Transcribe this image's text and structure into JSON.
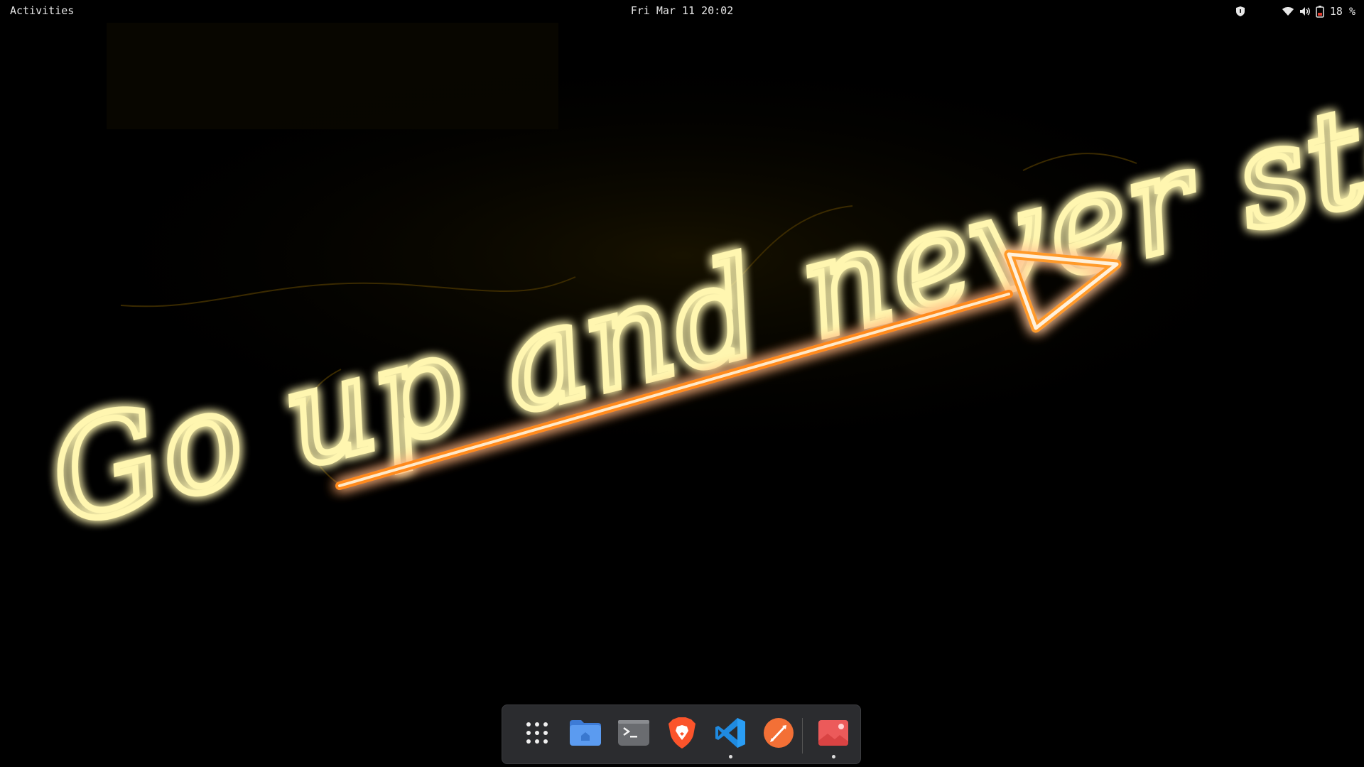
{
  "topbar": {
    "activities_label": "Activities",
    "clock": "Fri Mar 11 20:02",
    "tray": {
      "icons": [
        "shield-icon",
        "wifi-icon",
        "volume-icon",
        "battery-icon"
      ],
      "battery_percent": "18 %"
    }
  },
  "wallpaper": {
    "neon_text": "Go up and never stop",
    "colors": {
      "neon_yellow": "#fff6b0",
      "glow_yellow": "#ffcc00",
      "arrow_orange": "#ff7a1a",
      "background": "#000000"
    }
  },
  "dock": {
    "items": [
      {
        "name": "Show Applications",
        "icon": "app-grid-icon",
        "running": false
      },
      {
        "name": "Files",
        "icon": "files-folder-icon",
        "running": false
      },
      {
        "name": "Terminal",
        "icon": "terminal-icon",
        "running": false
      },
      {
        "name": "Brave",
        "icon": "brave-lion-icon",
        "running": false
      },
      {
        "name": "Visual Studio Code",
        "icon": "vscode-icon",
        "running": true
      },
      {
        "name": "Postman",
        "icon": "postman-icon",
        "running": false
      },
      {
        "name": "Image Viewer",
        "icon": "image-viewer-icon",
        "running": true
      }
    ]
  }
}
